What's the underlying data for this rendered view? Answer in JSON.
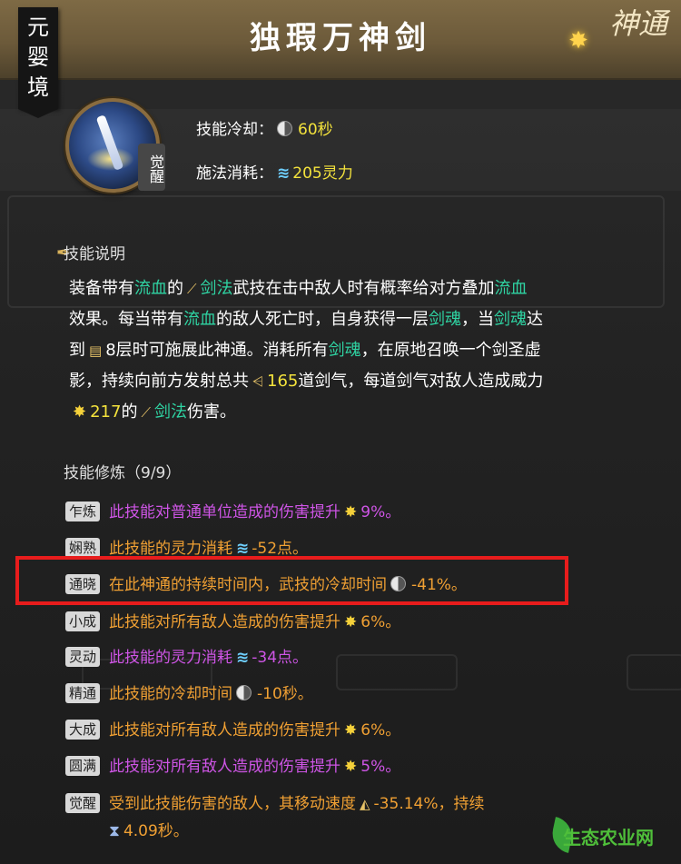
{
  "banner": {
    "title": "独瑕万神剑",
    "realm": "元婴境",
    "badge": "神通"
  },
  "skill": {
    "awakened_tag": "觉醒",
    "cooldown_label": "技能冷却：",
    "cooldown_value": "60秒",
    "cost_label": "施法消耗：",
    "cost_value": "205灵力"
  },
  "description": {
    "heading": "技能说明",
    "l1a": "装备带有",
    "l1b": "流血",
    "l1c": "的",
    "l1d": "剑法",
    "l1e": "武技在击中敌人时有概率给对方叠加",
    "l1f": "流血",
    "l2a": "效果。每当带有",
    "l2b": "流血",
    "l2c": "的敌人死亡时，自身获得一层",
    "l2d": "剑魂",
    "l2e": "，当",
    "l2f": "剑魂",
    "l2g": "达",
    "l3a": "到",
    "l3b": "8层时可施展此神通。消耗所有",
    "l3c": "剑魂",
    "l3d": "，在原地召唤一个剑圣虚",
    "l4a": "影，持续向前方发射总共",
    "l4b": "165",
    "l4c": "道剑气，每道剑气对敌人造成威力",
    "l5a": "217",
    "l5b": "的",
    "l5c": "剑法",
    "l5d": "伤害。"
  },
  "training": {
    "heading": "技能修炼（9/9）",
    "rows": [
      {
        "badge": "乍炼",
        "text": "此技能对普通单位造成的伤害提升",
        "value": "9%。"
      },
      {
        "badge": "娴熟",
        "text": "此技能的灵力消耗",
        "value": "-52点。"
      },
      {
        "badge": "通晓",
        "text": "在此神通的持续时间内，武技的冷却时间",
        "value": "-41%。"
      },
      {
        "badge": "小成",
        "text": "此技能对所有敌人造成的伤害提升",
        "value": "6%。"
      },
      {
        "badge": "灵动",
        "text": "此技能的灵力消耗",
        "value": "-34点。"
      },
      {
        "badge": "精通",
        "text": "此技能的冷却时间",
        "value": "-10秒。"
      },
      {
        "badge": "大成",
        "text": "此技能对所有敌人造成的伤害提升",
        "value": "6%。"
      },
      {
        "badge": "圆满",
        "text": "此技能对所有敌人造成的伤害提升",
        "value": "5%。"
      },
      {
        "badge": "觉醒",
        "text": "受到此技能伤害的敌人，其移动速度",
        "value": "-35.14%，持续",
        "text2": "4.09秒。"
      }
    ]
  },
  "watermark": "生态农业网",
  "colors": {
    "highlight": "#e81c1c",
    "keyword": "#2fd4a3",
    "number": "#f4e33c",
    "purple": "#cf55e6",
    "orange": "#f0a033"
  }
}
